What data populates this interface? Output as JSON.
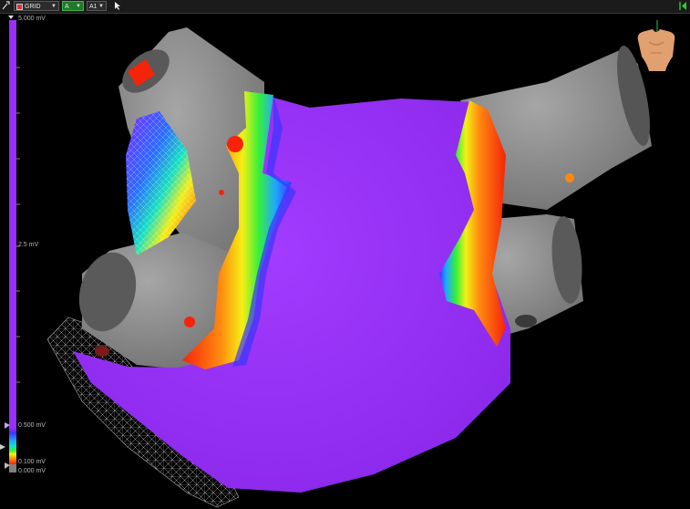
{
  "toolbar": {
    "map_type": "GRID",
    "channel": "A",
    "sub_channel": "A1",
    "map_type_icon": "grid-icon",
    "pointer_icon": "pointer-icon",
    "tool_icon": "wrench-icon",
    "panel_toggle_icon": "panel-toggle-icon"
  },
  "color_scale": {
    "top_label": "5.000 mV",
    "mid_label": "2.5 mV",
    "high_threshold_label": "0.500 mV",
    "low_threshold_label": "0.100 mV",
    "bottom_label": "0.000 mV",
    "high_value_mv": 0.5,
    "low_value_mv": 0.1,
    "above_range_color": "#9a2ff5",
    "gradient_colors": [
      "#9a2ff5",
      "#3a35ff",
      "#20a7ff",
      "#14e3c8",
      "#35f03a",
      "#f5f015",
      "#ff8a10",
      "#f5230a"
    ],
    "below_range_color": "#808080"
  },
  "map": {
    "scar_color": "#909090",
    "healthy_color": "#9a2ff5",
    "background": "#000000"
  },
  "orientation": {
    "icon": "torso-orientation-icon"
  }
}
